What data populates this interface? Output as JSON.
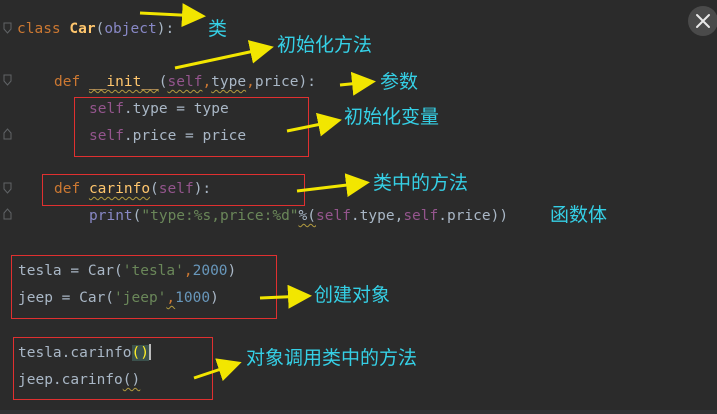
{
  "code": {
    "l1": {
      "kw": "class",
      "name": "Car",
      "open": "(",
      "base": "object",
      "close": "):"
    },
    "l2": {
      "kw": "def",
      "name": "__init__",
      "open": "(",
      "self": "self",
      "p1": "type",
      "p2": "price",
      "close": "):"
    },
    "l3": {
      "self": "self",
      "rest": ".type = type"
    },
    "l4": {
      "self": "self",
      "rest": ".price = price"
    },
    "l5": {
      "kw": "def",
      "name": "carinfo",
      "open": "(",
      "self": "self",
      "close": "):"
    },
    "l6": {
      "fn": "print",
      "open": "(",
      "fmt": "\"type:%s,price:%d\"",
      "mid": "%(",
      "self1": "self",
      "a1": ".type,",
      "self2": "self",
      "a2": ".price))"
    },
    "l7": {
      "left": "tesla = Car(",
      "str": "'tesla'",
      "comma": ",",
      "num": "2000",
      "close": ")"
    },
    "l8": {
      "left": "jeep = Car(",
      "str": "'jeep'",
      "comma": ",",
      "num": "1000",
      "close": ")"
    },
    "l9": {
      "left": "tesla.carinfo",
      "paren": "()"
    },
    "l10": {
      "left": "jeep.carinfo",
      "paren": "()"
    }
  },
  "annotations": {
    "class": "类",
    "init_method": "初始化方法",
    "params": "参数",
    "init_vars": "初始化变量",
    "method_in_class": "类中的方法",
    "function_body": "函数体",
    "create_object": "创建对象",
    "object_call": "对象调用类中的方法"
  },
  "icons": {
    "close": "close-icon",
    "fold": "fold-marker-icon"
  },
  "colors": {
    "background": "#2b2b2b",
    "keyword": "#cc7832",
    "self": "#94558d",
    "string": "#6a8759",
    "number": "#6897bb",
    "annotation_text": "#35d0e6",
    "annotation_arrow": "#f2e600",
    "box": "#e03030"
  }
}
